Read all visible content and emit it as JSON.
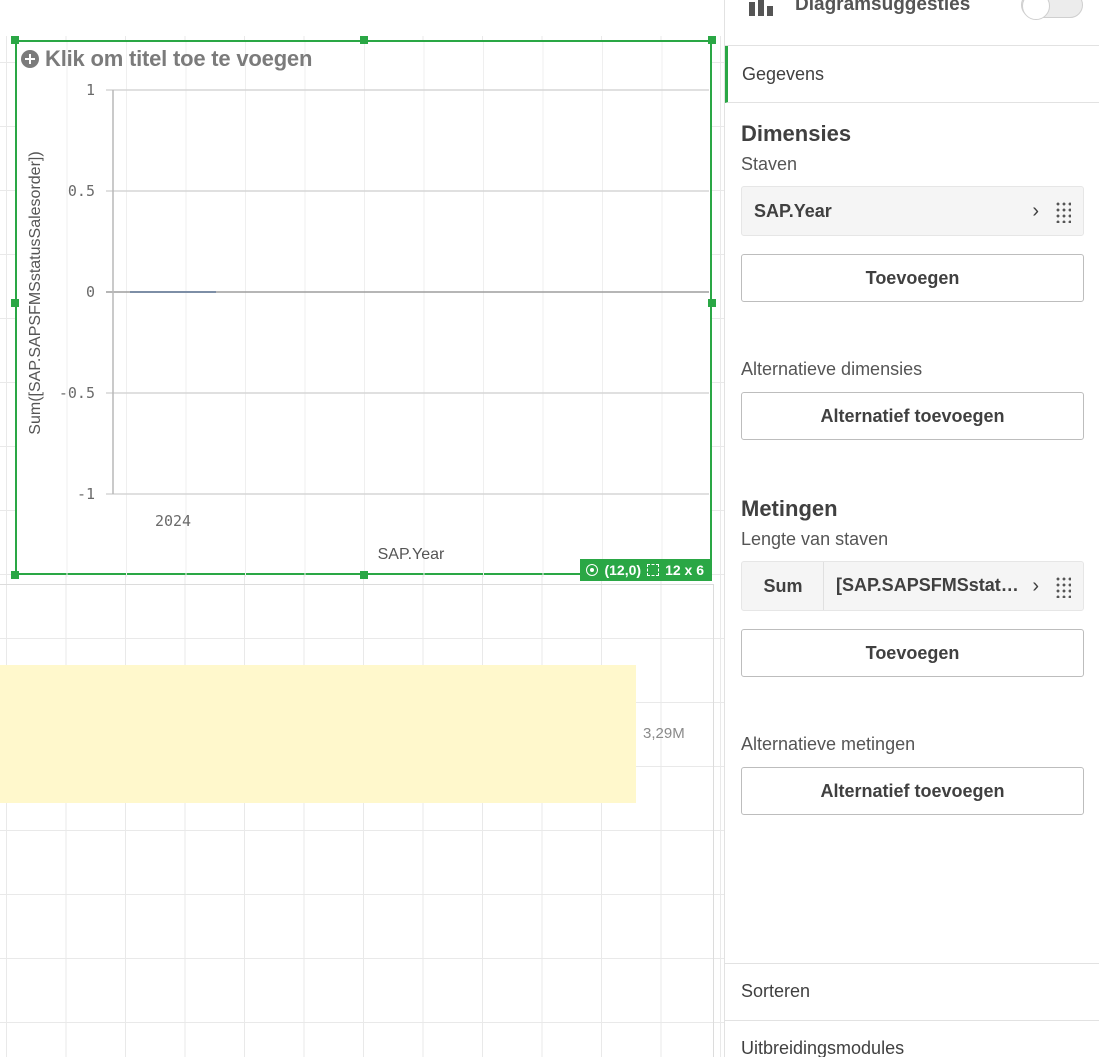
{
  "chart": {
    "title_placeholder": "Klik om titel toe te voegen",
    "position": "(12,0)",
    "size": "12 x 6",
    "accent": "#2aa745"
  },
  "chart_data": {
    "type": "bar",
    "categories": [
      "2024"
    ],
    "values": [
      0
    ],
    "title": "",
    "xlabel": "SAP.Year",
    "ylabel": "Sum([SAP.SAPSFMSstatusSalesorder])",
    "yticks": [
      "1",
      "0.5",
      "0",
      "-0.5",
      "-1"
    ],
    "ylim": [
      -1,
      1
    ],
    "grid": true
  },
  "lower_chart": {
    "value_label": "3,29M",
    "bar_color": "#fff8cc"
  },
  "panel": {
    "suggestions_label": "Diagramsuggesties",
    "tab_data": "Gegevens",
    "dimensions": {
      "title": "Dimensies",
      "bars_label": "Staven",
      "field": "SAP.Year",
      "add_button": "Toevoegen",
      "alt_label": "Alternatieve dimensies",
      "alt_button": "Alternatief toevoegen"
    },
    "measures": {
      "title": "Metingen",
      "length_label": "Lengte van staven",
      "aggregation": "Sum",
      "field": "[SAP.SAPSFMSstatusSalesorder]",
      "add_button": "Toevoegen",
      "alt_label": "Alternatieve metingen",
      "alt_button": "Alternatief toevoegen"
    },
    "sort_label": "Sorteren",
    "addons_label": "Uitbreidingsmodules"
  }
}
